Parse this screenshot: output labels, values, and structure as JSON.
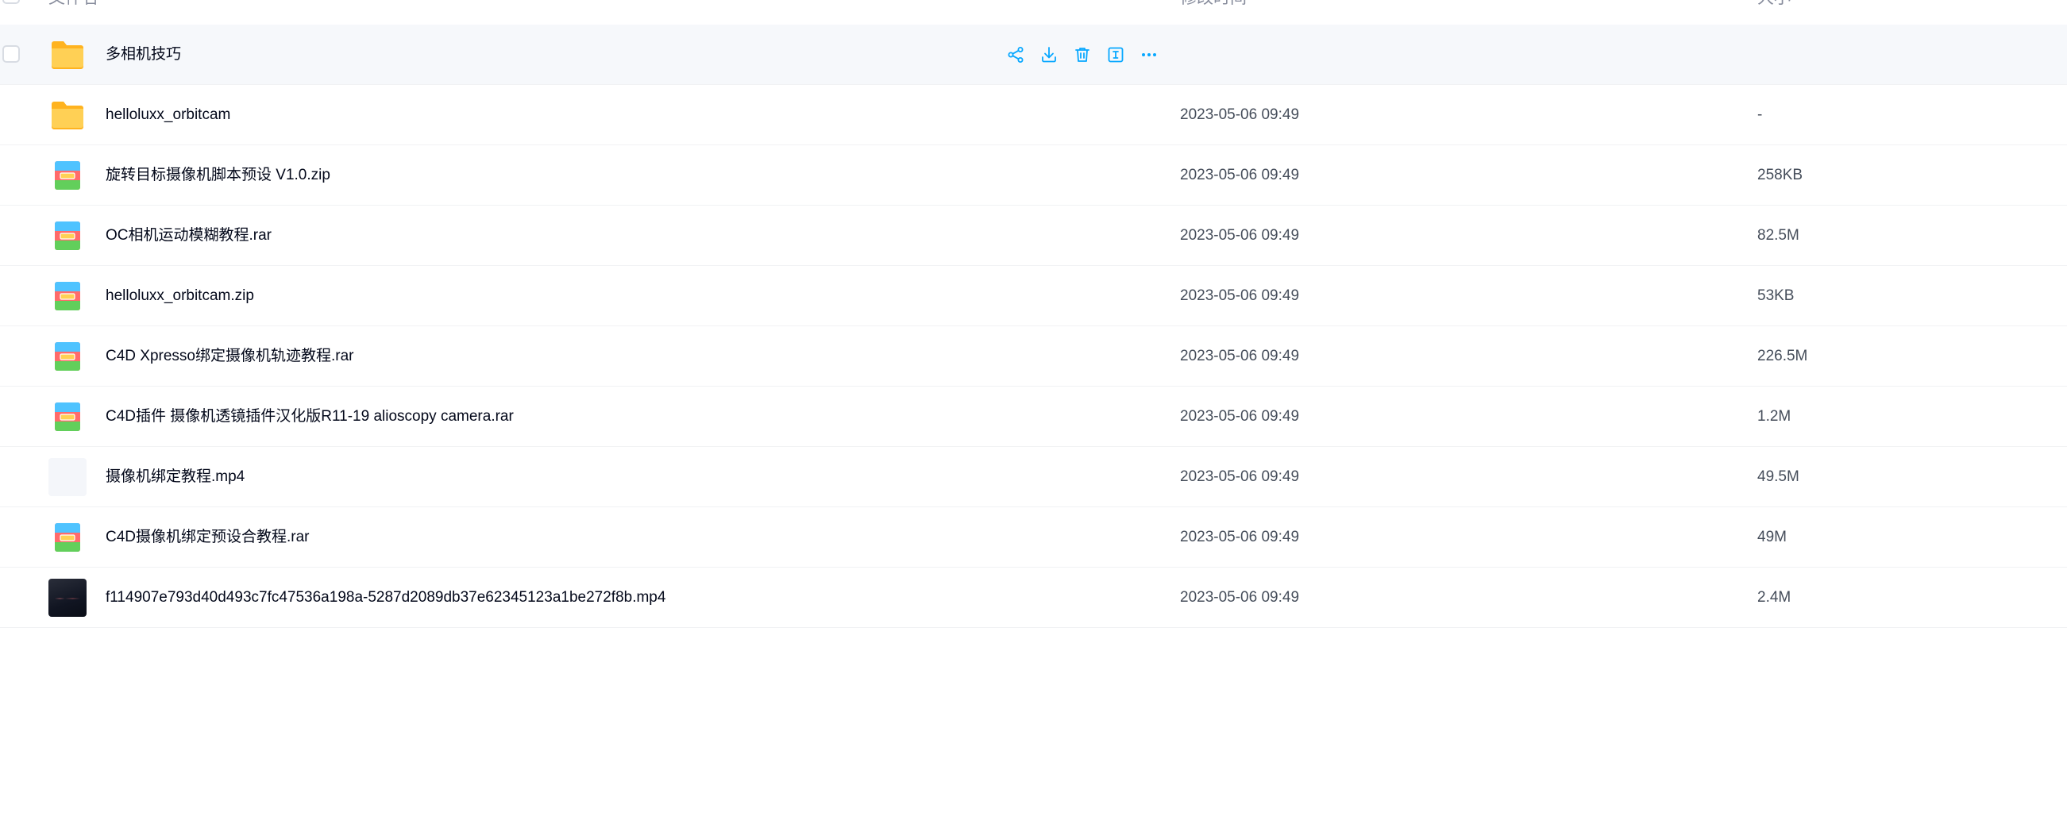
{
  "header": {
    "name": "文件名",
    "date": "修改时间",
    "size": "大小"
  },
  "actions": {
    "share": "share-icon",
    "download": "download-icon",
    "delete": "trash-icon",
    "rename": "rename-icon",
    "more": "more-icon"
  },
  "colors": {
    "accent": "#06a7ff",
    "folder": "#ffc533",
    "hover_row": "#f6f8fb"
  },
  "files": [
    {
      "name": "多相机技巧",
      "date": "",
      "size": "",
      "type": "folder",
      "hovered": true
    },
    {
      "name": "helloluxx_orbitcam",
      "date": "2023-05-06 09:49",
      "size": "-",
      "type": "folder"
    },
    {
      "name": "旋转目标摄像机脚本预设 V1.0.zip",
      "date": "2023-05-06 09:49",
      "size": "258KB",
      "type": "archive"
    },
    {
      "name": "OC相机运动模糊教程.rar",
      "date": "2023-05-06 09:49",
      "size": "82.5M",
      "type": "archive"
    },
    {
      "name": "helloluxx_orbitcam.zip",
      "date": "2023-05-06 09:49",
      "size": "53KB",
      "type": "archive"
    },
    {
      "name": "C4D Xpresso绑定摄像机轨迹教程.rar",
      "date": "2023-05-06 09:49",
      "size": "226.5M",
      "type": "archive"
    },
    {
      "name": "C4D插件 摄像机透镜插件汉化版R11-19 alioscopy camera.rar",
      "date": "2023-05-06 09:49",
      "size": "1.2M",
      "type": "archive"
    },
    {
      "name": "摄像机绑定教程.mp4",
      "date": "2023-05-06 09:49",
      "size": "49.5M",
      "type": "video-blank"
    },
    {
      "name": "C4D摄像机绑定预设合教程.rar",
      "date": "2023-05-06 09:49",
      "size": "49M",
      "type": "archive"
    },
    {
      "name": "f114907e793d40d493c7fc47536a198a-5287d2089db37e62345123a1be272f8b.mp4",
      "date": "2023-05-06 09:49",
      "size": "2.4M",
      "type": "video-dark"
    }
  ]
}
